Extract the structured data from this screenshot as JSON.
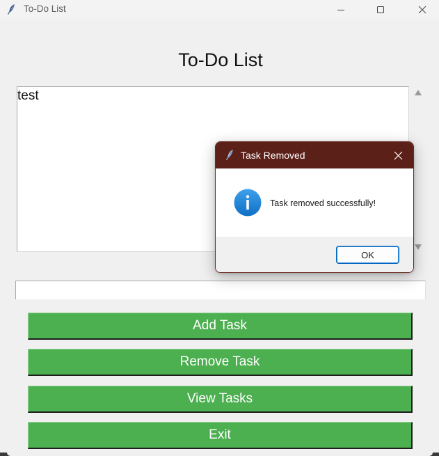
{
  "window": {
    "title": "To-Do List",
    "icon": "feather-icon",
    "controls": [
      "minimize-icon",
      "maximize-icon",
      "close-icon"
    ]
  },
  "main": {
    "heading": "To-Do List",
    "tasks": [
      "test"
    ],
    "task_entry": {
      "value": "",
      "placeholder": ""
    },
    "buttons": {
      "add": "Add Task",
      "remove": "Remove Task",
      "view": "View Tasks",
      "exit": "Exit"
    }
  },
  "dialog": {
    "title": "Task Removed",
    "icon": "info-icon",
    "message": "Task removed successfully!",
    "ok_label": "OK"
  },
  "colors": {
    "button_green": "#4caf50",
    "dialog_titlebar": "#5b2018",
    "info_blue": "#1a7fd6",
    "ok_border": "#0067c0"
  }
}
